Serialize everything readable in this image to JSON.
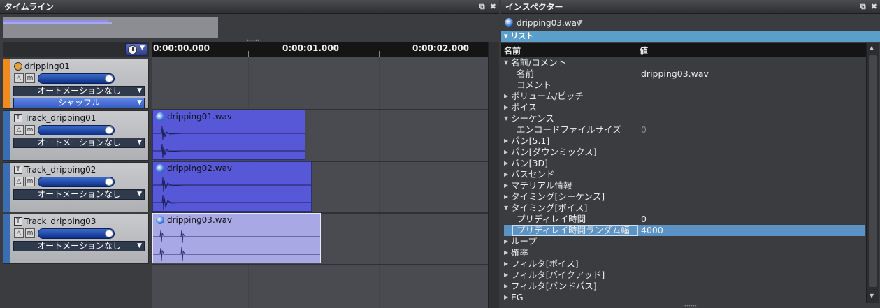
{
  "timeline": {
    "title": "タイムライン",
    "window_icons": [
      "⧉",
      "✖"
    ],
    "ruler": {
      "labels": [
        "0:00:00.000",
        "0:00:01.000",
        "0:00:02.000"
      ]
    },
    "tracks": [
      {
        "name": "dripping01",
        "kind": "cue",
        "stripe_color": "#f08a1f",
        "mini_icons": [
          "△",
          "m"
        ],
        "dropdowns": [
          "オートメーションなし",
          "シャッフル"
        ],
        "clip": null
      },
      {
        "name": "Track_dripping01",
        "kind": "track",
        "stripe_color": "#3b6db3",
        "mini_icons": [
          "△",
          "m"
        ],
        "dropdowns": [
          "オートメーションなし"
        ],
        "clip": {
          "name": "dripping01.wav",
          "selected": false
        }
      },
      {
        "name": "Track_dripping02",
        "kind": "track",
        "stripe_color": "#3b6db3",
        "mini_icons": [
          "△",
          "m"
        ],
        "dropdowns": [
          "オートメーションなし"
        ],
        "clip": {
          "name": "dripping02.wav",
          "selected": false
        }
      },
      {
        "name": "Track_dripping03",
        "kind": "track",
        "stripe_color": "#3b6db3",
        "mini_icons": [
          "△",
          "m"
        ],
        "dropdowns": [
          "オートメーションなし"
        ],
        "clip": {
          "name": "dripping03.wav",
          "selected": true
        }
      }
    ],
    "dropdown_arrow": "▼",
    "track_icon_letter": "T"
  },
  "inspector": {
    "title": "インスペクター",
    "window_icons": [
      "⧉",
      "✖"
    ],
    "file": "dripping03.wav",
    "list_header": "リスト",
    "columns": {
      "name": "名前",
      "value": "値"
    },
    "rows": [
      {
        "name": "名前/コメント",
        "level": 0,
        "expand": "open"
      },
      {
        "name": "名前",
        "level": 1,
        "value": "dripping03.wav"
      },
      {
        "name": "コメント",
        "level": 1,
        "value": ""
      },
      {
        "name": "ボリューム/ピッチ",
        "level": 0,
        "expand": "closed"
      },
      {
        "name": "ボイス",
        "level": 0,
        "expand": "closed"
      },
      {
        "name": "シーケンス",
        "level": 0,
        "expand": "open"
      },
      {
        "name": "エンコードファイルサイズ",
        "level": 1,
        "value": "0",
        "dim": true
      },
      {
        "name": "パン[5.1]",
        "level": 0,
        "expand": "closed"
      },
      {
        "name": "パン[ダウンミックス]",
        "level": 0,
        "expand": "closed"
      },
      {
        "name": "パン[3D]",
        "level": 0,
        "expand": "closed"
      },
      {
        "name": "バスセンド",
        "level": 0,
        "expand": "closed"
      },
      {
        "name": "マテリアル情報",
        "level": 0,
        "expand": "closed"
      },
      {
        "name": "タイミング[シーケンス]",
        "level": 0,
        "expand": "closed"
      },
      {
        "name": "タイミング[ボイス]",
        "level": 0,
        "expand": "open"
      },
      {
        "name": "プリディレイ時間",
        "level": 1,
        "value": "0"
      },
      {
        "name": "プリディレイ時間ランダム幅",
        "level": 1,
        "value": "4000",
        "selected": true
      },
      {
        "name": "ループ",
        "level": 0,
        "expand": "closed"
      },
      {
        "name": "確率",
        "level": 0,
        "expand": "closed"
      },
      {
        "name": "フィルタ[ボイス]",
        "level": 0,
        "expand": "closed"
      },
      {
        "name": "フィルタ[バイクアッド]",
        "level": 0,
        "expand": "closed"
      },
      {
        "name": "フィルタ[バンドパス]",
        "level": 0,
        "expand": "closed"
      },
      {
        "name": "EG",
        "level": 0,
        "expand": "closed"
      }
    ]
  },
  "colors": {
    "clip_fill": "#5658d8",
    "clip_selected_fill": "#a7a8e4",
    "selection_highlight": "#5a93c4",
    "list_header": "#5b9ec9"
  }
}
